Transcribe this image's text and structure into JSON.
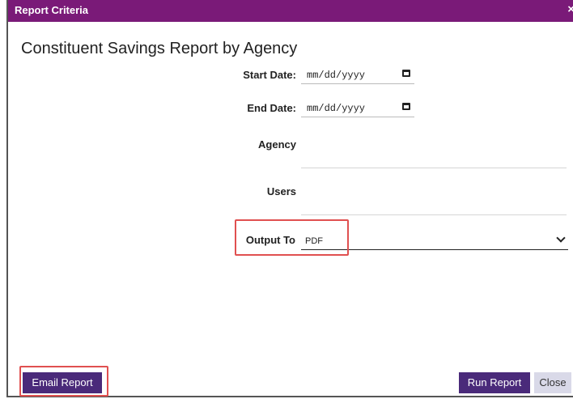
{
  "dialog": {
    "title": "Report Criteria",
    "close_glyph": "×",
    "report_title": "Constituent Savings Report by Agency"
  },
  "form": {
    "start_date_label": "Start Date:",
    "start_date_value": "mm/dd/yyyy",
    "end_date_label": "End Date:",
    "end_date_value": "mm/dd/yyyy",
    "agency_label": "Agency",
    "users_label": "Users",
    "output_label": "Output To",
    "output_value": "PDF"
  },
  "buttons": {
    "email_report": "Email Report",
    "run_report": "Run Report",
    "close": "Close"
  },
  "icons": {
    "calendar": "calendar-icon",
    "dropdown": "chevron-down-icon",
    "close": "close-icon"
  },
  "colors": {
    "titlebar": "#7a1a78",
    "primary_button": "#4a2a7a",
    "secondary_button": "#d9d9e8",
    "highlight": "#e05050"
  }
}
